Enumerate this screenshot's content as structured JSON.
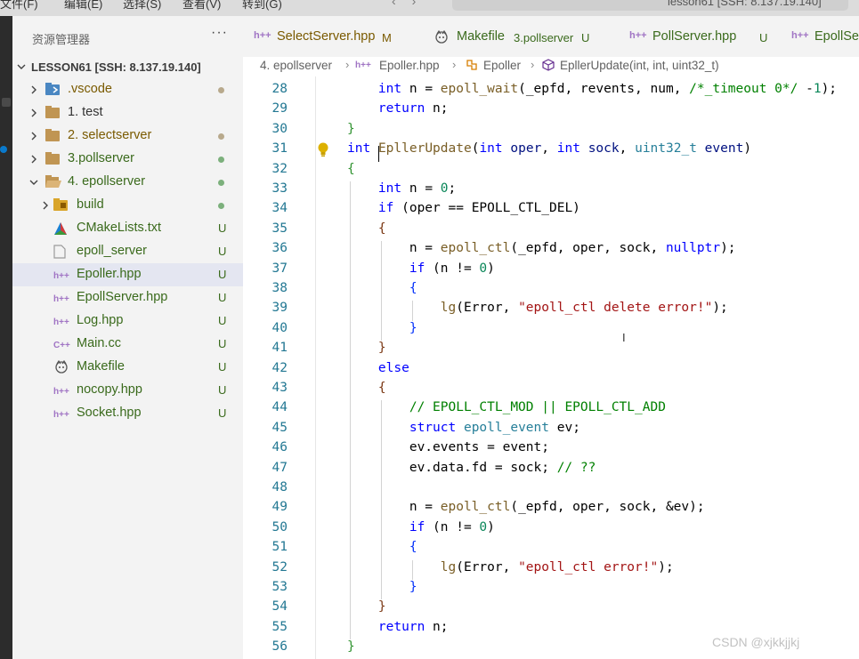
{
  "titlebar": {
    "menu": [
      "文件(F)",
      "编辑(E)",
      "选择(S)",
      "查看(V)",
      "转到(G)"
    ],
    "command_center": "lesson61 [SSH: 8.137.19.140]"
  },
  "sidebar": {
    "title": "资源管理器",
    "more": "···",
    "root": "LESSON61 [SSH: 8.137.19.140]",
    "items": [
      {
        "label": ".vscode",
        "icon": "vscode-folder-icon",
        "status": "dot",
        "status_color": "#b8a98c",
        "label_color": "#7a5a00"
      },
      {
        "label": "1. test",
        "icon": "folder-icon",
        "status": "",
        "status_color": "",
        "label_color": "#333333"
      },
      {
        "label": "2. selectserver",
        "icon": "folder-icon",
        "status": "dot",
        "status_color": "#b8a98c",
        "label_color": "#7a5a00"
      },
      {
        "label": "3.pollserver",
        "icon": "folder-icon",
        "status": "dot",
        "status_color": "#7cb07c",
        "label_color": "#3a6a1c"
      },
      {
        "label": "4. epollserver",
        "icon": "folder-open-icon",
        "status": "dot",
        "status_color": "#7cb07c",
        "label_color": "#3a6a1c"
      },
      {
        "label": "build",
        "icon": "build-folder-icon",
        "status": "dot",
        "status_color": "#7cb07c",
        "label_color": "#3a6a1c"
      },
      {
        "label": "CMakeLists.txt",
        "icon": "cmake-icon",
        "status": "U",
        "status_color": "#3a6a1c",
        "label_color": "#3a6a1c"
      },
      {
        "label": "epoll_server",
        "icon": "file-icon",
        "status": "U",
        "status_color": "#3a6a1c",
        "label_color": "#3a6a1c"
      },
      {
        "label": "Epoller.hpp",
        "icon": "hpp-icon",
        "status": "U",
        "status_color": "#3a6a1c",
        "label_color": "#3a6a1c"
      },
      {
        "label": "EpollServer.hpp",
        "icon": "hpp-icon",
        "status": "U",
        "status_color": "#3a6a1c",
        "label_color": "#3a6a1c"
      },
      {
        "label": "Log.hpp",
        "icon": "hpp-icon",
        "status": "U",
        "status_color": "#3a6a1c",
        "label_color": "#3a6a1c"
      },
      {
        "label": "Main.cc",
        "icon": "cpp-icon",
        "status": "U",
        "status_color": "#3a6a1c",
        "label_color": "#3a6a1c"
      },
      {
        "label": "Makefile",
        "icon": "makefile-icon",
        "status": "U",
        "status_color": "#3a6a1c",
        "label_color": "#3a6a1c"
      },
      {
        "label": "nocopy.hpp",
        "icon": "hpp-icon",
        "status": "U",
        "status_color": "#3a6a1c",
        "label_color": "#3a6a1c"
      },
      {
        "label": "Socket.hpp",
        "icon": "hpp-icon",
        "status": "U",
        "status_color": "#3a6a1c",
        "label_color": "#3a6a1c"
      }
    ]
  },
  "tabs": [
    {
      "icon": "h++",
      "label": "SelectServer.hpp",
      "state": "M",
      "label_color": "#7a5a00"
    },
    {
      "icon": "mk",
      "label": "Makefile",
      "extra": "3.pollserver",
      "state": "U",
      "label_color": "#3a6a1c"
    },
    {
      "icon": "h++",
      "label": "PollServer.hpp",
      "state": "U",
      "label_color": "#3a6a1c"
    },
    {
      "icon": "h++",
      "label": "EpollSe",
      "state": "",
      "label_color": "#3a6a1c"
    }
  ],
  "breadcrumb": {
    "folder": "4. epollserver",
    "file": "Epoller.hpp",
    "class": "Epoller",
    "method": "EpllerUpdate(int, int, uint32_t)"
  },
  "editor": {
    "first_line": 28,
    "last_line": 56
  },
  "watermark": "CSDN @xjkkjjkj"
}
